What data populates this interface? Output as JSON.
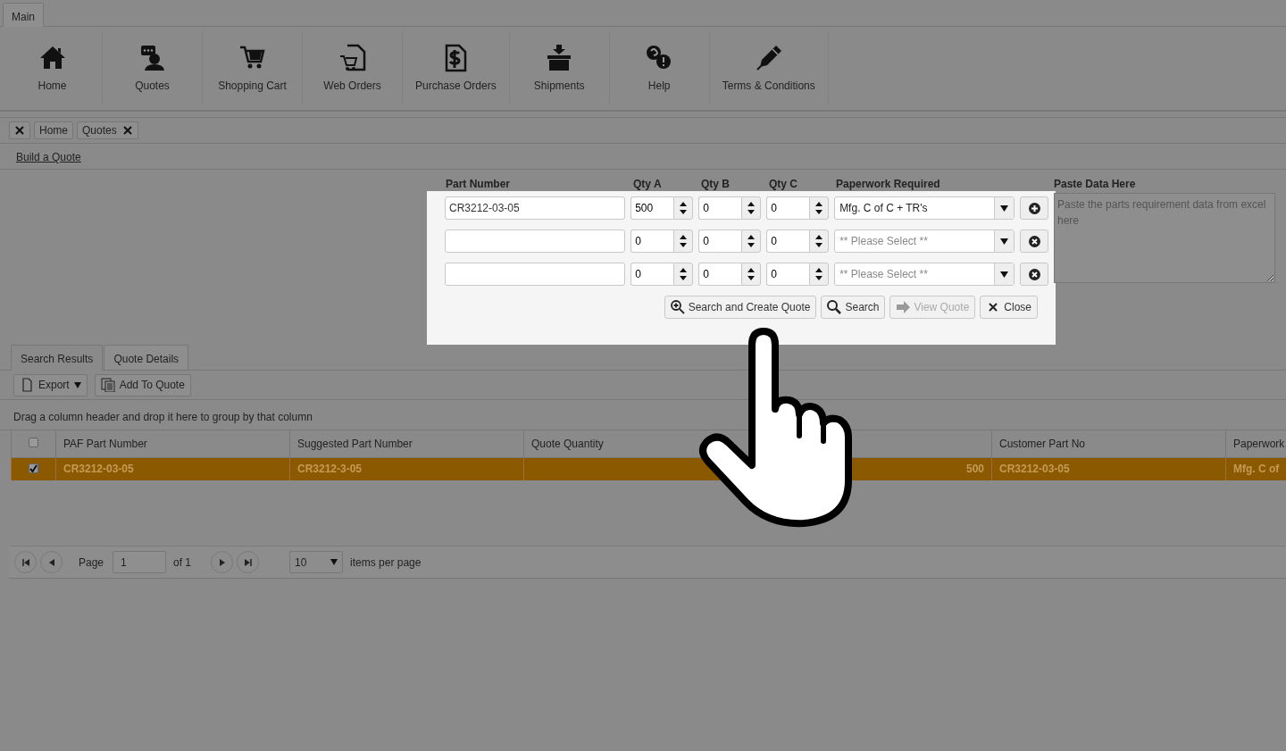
{
  "menu_tabs": [
    {
      "label": "Main",
      "selected": true
    }
  ],
  "ribbon": [
    {
      "label": "Home",
      "kind": "home"
    },
    {
      "label": "Quotes",
      "kind": "person-chat"
    },
    {
      "label": "Shopping Cart",
      "kind": "cart"
    },
    {
      "label": "Web Orders",
      "kind": "doc-cart"
    },
    {
      "label": "Purchase Orders",
      "kind": "doc-dollar"
    },
    {
      "label": "Shipments",
      "kind": "box"
    },
    {
      "label": "Help",
      "kind": "help"
    },
    {
      "label": "Terms & Conditions",
      "kind": "pen"
    }
  ],
  "open_tabs": [
    {
      "label": "Home",
      "closable": false
    },
    {
      "label": "Quotes",
      "closable": true
    }
  ],
  "link": "Build a Quote",
  "form": {
    "columns": [
      "Part Number",
      "Qty A",
      "Qty B",
      "Qty C",
      "Paperwork Required"
    ],
    "rows": [
      {
        "part_number": "CR3212-03-05",
        "qty_a": "500",
        "qty_b": "0",
        "qty_c": "0",
        "paperwork": {
          "value": "Mfg. C of C + TR's"
        },
        "kind": "add"
      },
      {
        "qty_a": "0",
        "qty_b": "0",
        "qty_c": "0",
        "paperwork": {
          "placeholder": "** Please Select **"
        },
        "kind": "remove"
      },
      {
        "qty_a": "0",
        "qty_b": "0",
        "qty_c": "0",
        "paperwork": {
          "placeholder": "** Please Select **"
        },
        "kind": "remove"
      }
    ],
    "buttons": [
      {
        "label": "Search and Create Quote",
        "kind": "zoom-plus",
        "disabled": false
      },
      {
        "label": "Search",
        "kind": "search",
        "disabled": false
      },
      {
        "label": "View Quote",
        "kind": "arrow",
        "disabled": true
      },
      {
        "label": "Close",
        "kind": "close",
        "disabled": false
      }
    ],
    "paste": {
      "label": "Paste Data Here",
      "placeholder": "Paste the parts requirement data from excel here"
    }
  },
  "results_tabs": [
    {
      "label": "Search Results",
      "selected": true
    },
    {
      "label": "Quote Details",
      "selected": false
    }
  ],
  "toolbar": [
    {
      "label": "Export",
      "kind": "document",
      "dropdown": true
    },
    {
      "label": "Add To Quote",
      "kind": "copy",
      "dropdown": false
    }
  ],
  "group_hint": "Drag a column header and drop it here to group by that column",
  "grid": {
    "header_checked": false,
    "columns": [
      {
        "label": "PAF Part Number"
      },
      {
        "label": "Suggested Part Number"
      },
      {
        "label": "Quote Quantity"
      },
      {},
      {
        "label": "Customer Part No"
      },
      {
        "label": "Paperwork"
      }
    ],
    "rows": [
      {
        "selected": true,
        "checked": true,
        "cells": [
          {
            "text": "CR3212-03-05"
          },
          {
            "text": "CR3212-3-05"
          },
          {},
          {
            "text": "500"
          },
          {
            "text": "CR3212-03-05"
          },
          {
            "text": "Mfg. C of"
          }
        ]
      }
    ]
  },
  "pager": {
    "page_label": "Page",
    "page": "1",
    "of": "of 1",
    "page_size": "10",
    "per_page_label": "items per page"
  }
}
